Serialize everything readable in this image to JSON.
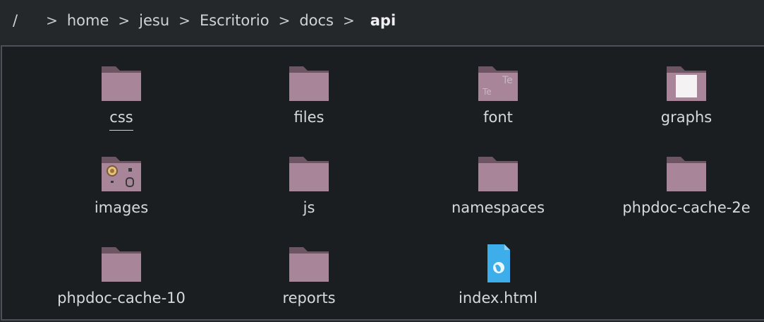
{
  "breadcrumb": {
    "root": "/",
    "items": [
      "home",
      "jesu",
      "Escritorio",
      "docs"
    ],
    "current": "api"
  },
  "folder_color": "#a9859a",
  "items": [
    {
      "name": "css",
      "icon": "folder-icon"
    },
    {
      "name": "files",
      "icon": "folder-icon"
    },
    {
      "name": "font",
      "icon": "folder-font-icon"
    },
    {
      "name": "graphs",
      "icon": "folder-graphs-icon"
    },
    {
      "name": "images",
      "icon": "folder-images-icon"
    },
    {
      "name": "js",
      "icon": "folder-icon"
    },
    {
      "name": "namespaces",
      "icon": "folder-icon"
    },
    {
      "name": "phpdoc-cache-2e",
      "icon": "folder-icon"
    },
    {
      "name": "phpdoc-cache-10",
      "icon": "folder-icon"
    },
    {
      "name": "reports",
      "icon": "folder-icon"
    },
    {
      "name": "index.html",
      "icon": "html-file-icon"
    }
  ]
}
